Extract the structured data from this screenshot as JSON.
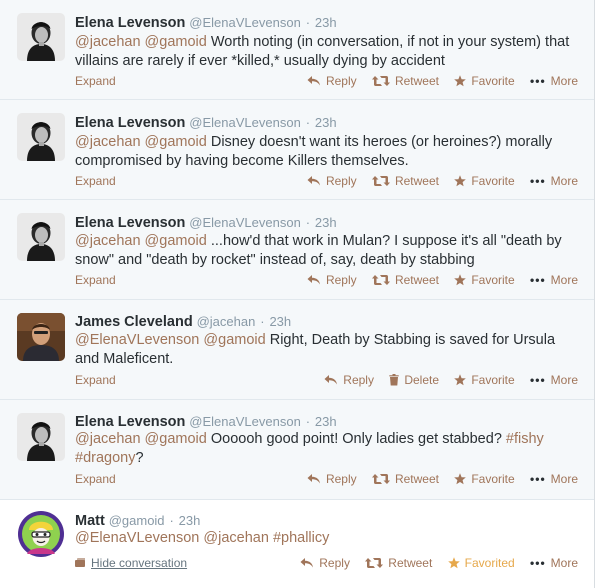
{
  "tweets": [
    {
      "fullname": "Elena Levenson",
      "username": "@ElenaVLevenson",
      "time": "23h",
      "mentions": [
        "@jacehan",
        "@gamoid"
      ],
      "text": "Worth noting (in conversation, if not in your system) that villains are rarely if ever *killed,* usually dying by accident",
      "expand": "Expand",
      "actions": {
        "reply": "Reply",
        "retweet": "Retweet",
        "favorite": "Favorite",
        "more": "More"
      }
    },
    {
      "fullname": "Elena Levenson",
      "username": "@ElenaVLevenson",
      "time": "23h",
      "mentions": [
        "@jacehan",
        "@gamoid"
      ],
      "text": "Disney doesn't want its heroes (or heroines?) morally compromised by having become Killers themselves.",
      "expand": "Expand",
      "actions": {
        "reply": "Reply",
        "retweet": "Retweet",
        "favorite": "Favorite",
        "more": "More"
      }
    },
    {
      "fullname": "Elena Levenson",
      "username": "@ElenaVLevenson",
      "time": "23h",
      "mentions": [
        "@jacehan",
        "@gamoid"
      ],
      "text": "...how'd that work in Mulan? I suppose it's all \"death by snow\" and \"death by rocket\" instead of, say, death by stabbing",
      "expand": "Expand",
      "actions": {
        "reply": "Reply",
        "retweet": "Retweet",
        "favorite": "Favorite",
        "more": "More"
      }
    },
    {
      "fullname": "James Cleveland",
      "username": "@jacehan",
      "time": "23h",
      "mentions": [
        "@ElenaVLevenson",
        "@gamoid"
      ],
      "text": "Right, Death by Stabbing is saved for Ursula and Maleficent.",
      "expand": "Expand",
      "actions": {
        "reply": "Reply",
        "delete": "Delete",
        "favorite": "Favorite",
        "more": "More"
      }
    },
    {
      "fullname": "Elena Levenson",
      "username": "@ElenaVLevenson",
      "time": "23h",
      "mentions": [
        "@jacehan",
        "@gamoid"
      ],
      "text_before": "Oooooh good point! Only ladies get stabbed?",
      "hashtags": [
        "#fishy",
        "#dragony"
      ],
      "text_after": "?",
      "expand": "Expand",
      "actions": {
        "reply": "Reply",
        "retweet": "Retweet",
        "favorite": "Favorite",
        "more": "More"
      }
    },
    {
      "fullname": "Matt",
      "username": "@gamoid",
      "time": "23h",
      "mentions": [
        "@ElenaVLevenson",
        "@jacehan"
      ],
      "hashtag": "#phallicy",
      "hide_conversation": "Hide conversation",
      "actions": {
        "reply": "Reply",
        "retweet": "Retweet",
        "favorited": "Favorited",
        "more": "More"
      }
    }
  ],
  "colors": {
    "link": "#a0755a",
    "favorited": "#e6a84b",
    "meta": "#8899a6",
    "text": "#292f33",
    "row_bg": "#f5f8fa"
  },
  "icons": {
    "reply": "reply-arrow-icon",
    "retweet": "retweet-icon",
    "delete": "trash-icon",
    "favorite": "star-icon",
    "more": "dots-icon"
  }
}
